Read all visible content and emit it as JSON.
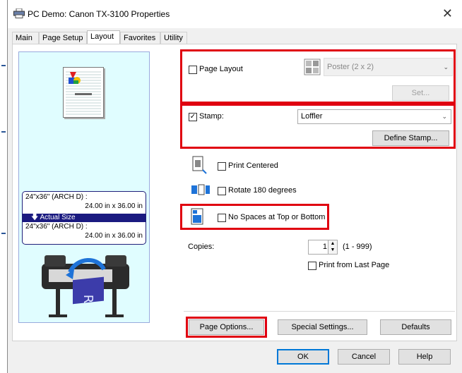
{
  "window": {
    "title": "PC Demo: Canon TX-3100 Properties",
    "close_glyph": "✕",
    "app_icon": "printer-icon"
  },
  "tabs": [
    {
      "label": "Main",
      "active": false
    },
    {
      "label": "Page Setup",
      "active": false
    },
    {
      "label": "Layout",
      "active": true
    },
    {
      "label": "Favorites",
      "active": false
    },
    {
      "label": "Utility",
      "active": false
    }
  ],
  "preview": {
    "size_top": "24\"x36\" (ARCH D) :",
    "size_top_dims": "24.00 in x 36.00 in",
    "actual_size": "Actual Size",
    "size_bottom": "24\"x36\" (ARCH D) :",
    "size_bottom_dims": "24.00 in x 36.00 in"
  },
  "page_layout": {
    "label": "Page Layout",
    "checked": false,
    "value": "Poster (2 x 2)",
    "set_button": "Set..."
  },
  "stamp": {
    "label": "Stamp:",
    "checked": true,
    "value": "Loffler",
    "define_button": "Define Stamp..."
  },
  "options": {
    "print_centered": "Print Centered",
    "rotate": "Rotate 180 degrees",
    "no_spaces": "No Spaces at Top or Bottom"
  },
  "copies": {
    "label": "Copies:",
    "value": "1",
    "range": "(1 - 999)",
    "print_last": "Print from Last Page"
  },
  "bottom_buttons": {
    "page_options": "Page Options...",
    "special_settings": "Special Settings...",
    "defaults": "Defaults"
  },
  "dialog_buttons": {
    "ok": "OK",
    "cancel": "Cancel",
    "help": "Help"
  },
  "colors": {
    "highlight": "#e00010",
    "preview_bg": "#e0fdff",
    "actual_size_bar": "#1a1a80"
  }
}
